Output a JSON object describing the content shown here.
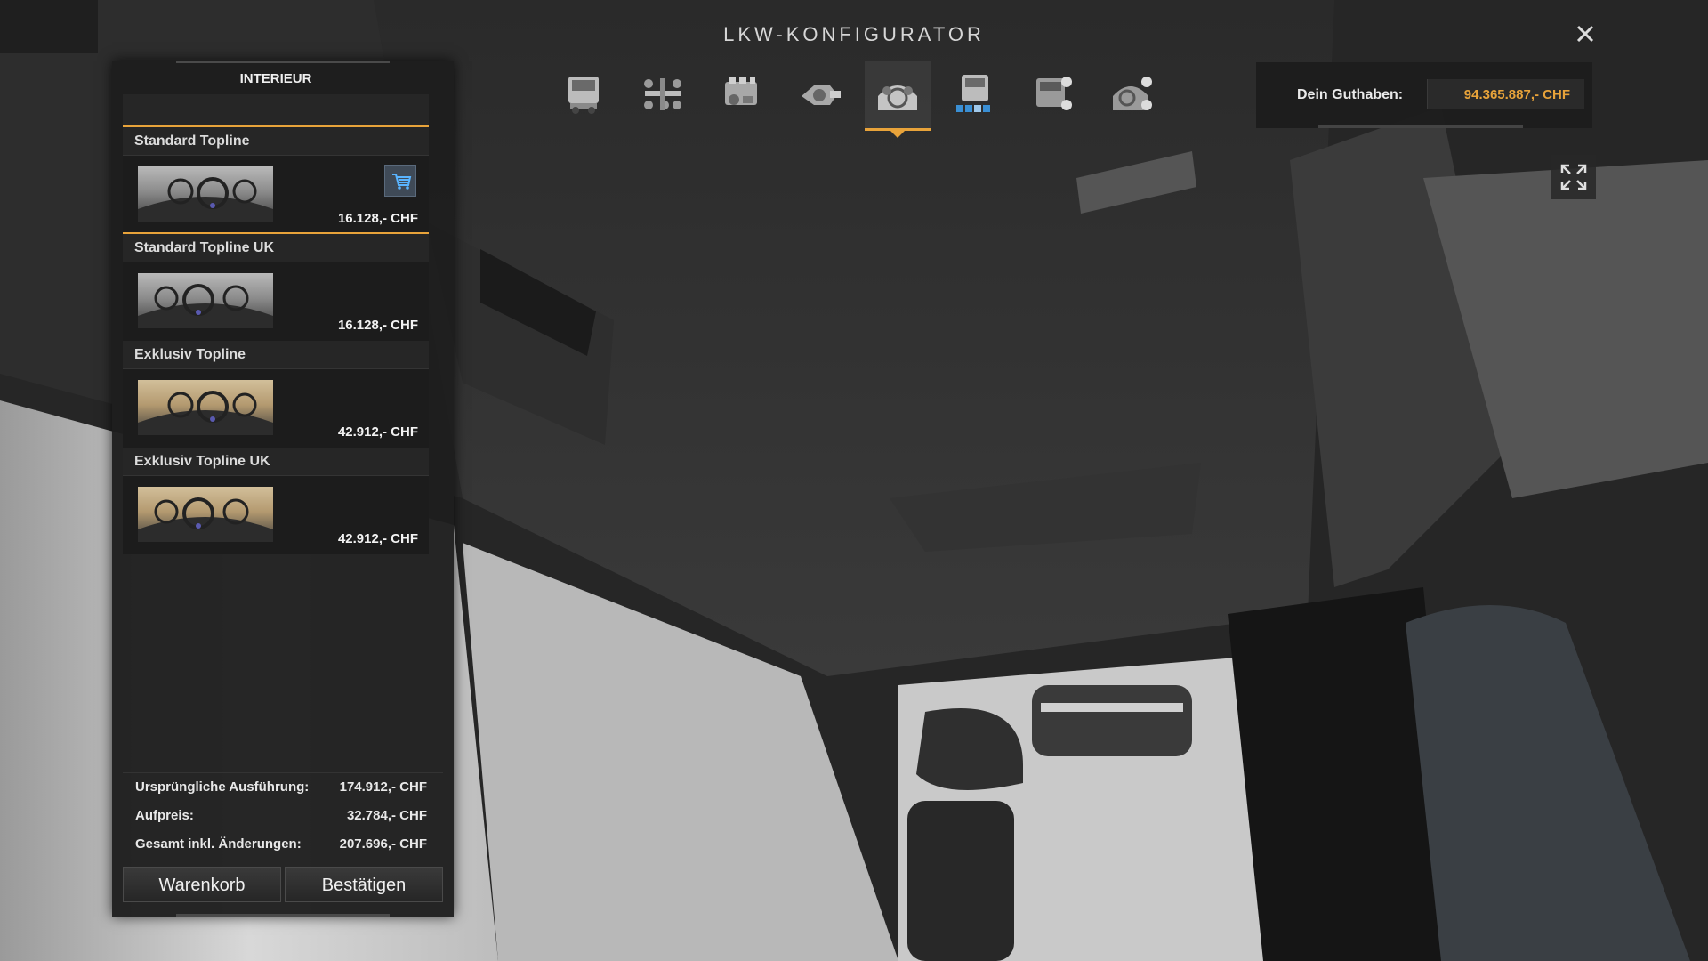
{
  "window": {
    "title": "LKW-KONFIGURATOR",
    "close_icon": "close-icon"
  },
  "panel": {
    "header": "INTERIEUR",
    "variants": [
      {
        "name": "Standard Topline",
        "price": "16.128,- CHF",
        "selected": true,
        "in_cart": true
      },
      {
        "name": "Standard Topline UK",
        "price": "16.128,- CHF",
        "selected": false,
        "in_cart": false
      },
      {
        "name": "Exklusiv Topline",
        "price": "42.912,- CHF",
        "selected": false,
        "in_cart": false
      },
      {
        "name": "Exklusiv Topline UK",
        "price": "42.912,- CHF",
        "selected": false,
        "in_cart": false
      }
    ],
    "summary": {
      "original_label": "Ursprüngliche Ausführung:",
      "original_value": "174.912,- CHF",
      "surcharge_label": "Aufpreis:",
      "surcharge_value": "32.784,- CHF",
      "total_label": "Gesamt inkl. Änderungen:",
      "total_value": "207.696,- CHF"
    },
    "buttons": {
      "cart": "Warenkorb",
      "confirm": "Bestätigen"
    }
  },
  "category_tabs": [
    {
      "icon": "truck-icon",
      "active": false
    },
    {
      "icon": "chassis-icon",
      "active": false
    },
    {
      "icon": "engine-icon",
      "active": false
    },
    {
      "icon": "transmission-icon",
      "active": false
    },
    {
      "icon": "interior-icon",
      "active": true
    },
    {
      "icon": "cabin-icon",
      "active": false
    },
    {
      "icon": "lights-icon",
      "active": false
    },
    {
      "icon": "accessories-icon",
      "active": false
    }
  ],
  "balance": {
    "label": "Dein Guthaben:",
    "value": "94.365.887,- CHF"
  },
  "colors": {
    "accent": "#e8a33a",
    "panel": "#1e1e1e",
    "cart_icon": "#3f4a57"
  }
}
